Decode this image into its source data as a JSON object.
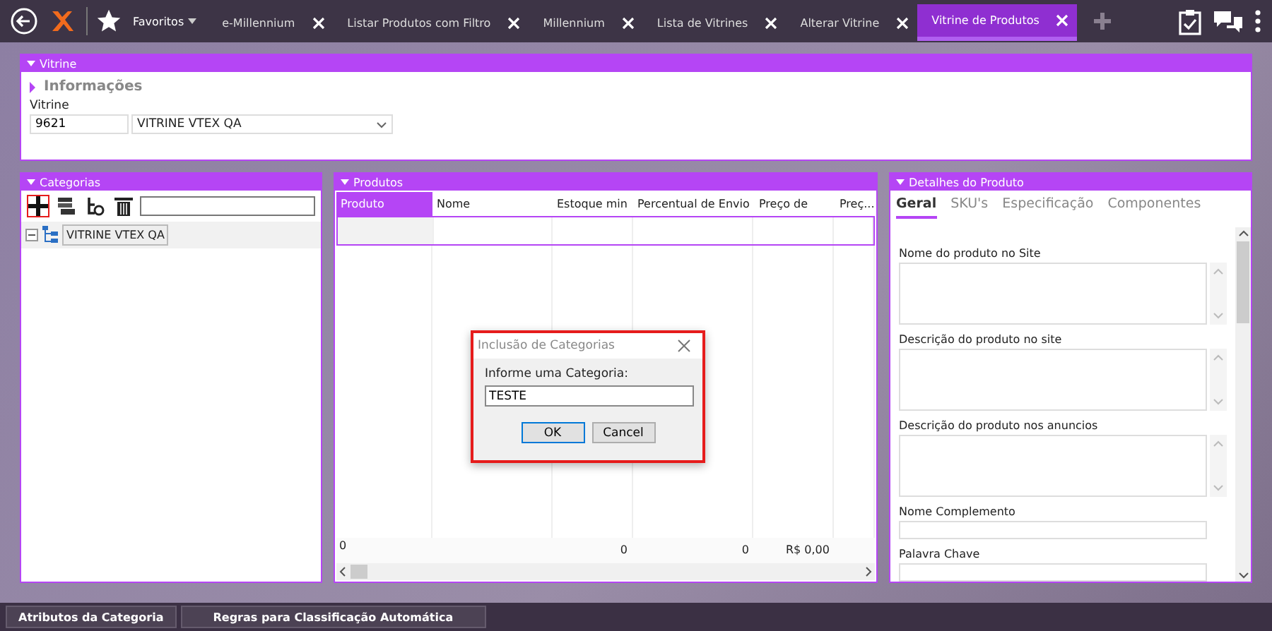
{
  "topbar": {
    "favorites": "Favoritos",
    "tabs": [
      {
        "label": "e-Millennium",
        "selected": false
      },
      {
        "label": "Listar Produtos com Filtro",
        "selected": false
      },
      {
        "label": "Millennium",
        "selected": false
      },
      {
        "label": "Lista de Vitrines",
        "selected": false
      },
      {
        "label": "Alterar Vitrine",
        "selected": false
      },
      {
        "label": "Vitrine de Produtos",
        "selected": true
      }
    ]
  },
  "vitrine": {
    "title": "Vitrine",
    "section": "Informações",
    "field_label": "Vitrine",
    "code": "9621",
    "name": "VITRINE VTEX QA"
  },
  "categorias": {
    "title": "Categorias",
    "tools": [
      {
        "kind": "add",
        "highlighted": true
      },
      {
        "kind": "list",
        "highlighted": false
      },
      {
        "kind": "subtree",
        "highlighted": false
      },
      {
        "kind": "delete",
        "highlighted": false
      }
    ],
    "tree": [
      {
        "label": "VITRINE VTEX QA",
        "expanded": true
      }
    ]
  },
  "produtos": {
    "title": "Produtos",
    "columns": [
      {
        "label": "Produto",
        "selected": true,
        "total": "0"
      },
      {
        "label": "Nome",
        "selected": false
      },
      {
        "label": "Estoque min",
        "selected": false,
        "total": "0"
      },
      {
        "label": "Percentual de Envio",
        "selected": false,
        "total": "0"
      },
      {
        "label": "Preço de",
        "selected": false,
        "total": "R$ 0,00"
      },
      {
        "label": "Preç...",
        "selected": false
      }
    ]
  },
  "dialog": {
    "title": "Inclusão de Categorias",
    "prompt": "Informe uma Categoria:",
    "value": "TESTE",
    "highlighted": true,
    "buttons": [
      {
        "label": "OK",
        "default": true
      },
      {
        "label": "Cancel",
        "default": false
      }
    ]
  },
  "detalhes": {
    "title": "Detalhes do Produto",
    "tabs": [
      {
        "label": "Geral",
        "selected": true
      },
      {
        "label": "SKU's",
        "selected": false
      },
      {
        "label": "Especificação",
        "selected": false
      },
      {
        "label": "Componentes",
        "selected": false
      }
    ],
    "fields": [
      {
        "label": "Nome do produto no Site",
        "kind": "textarea"
      },
      {
        "label": "Descrição do produto no site",
        "kind": "textarea"
      },
      {
        "label": "Descrição do produto nos anuncios",
        "kind": "textarea"
      },
      {
        "label": "Nome Complemento",
        "kind": "input"
      },
      {
        "label": "Palavra Chave",
        "kind": "input"
      }
    ]
  },
  "bottom_buttons": [
    "Atributos da Categoria",
    "Regras para Classificação Automática"
  ]
}
